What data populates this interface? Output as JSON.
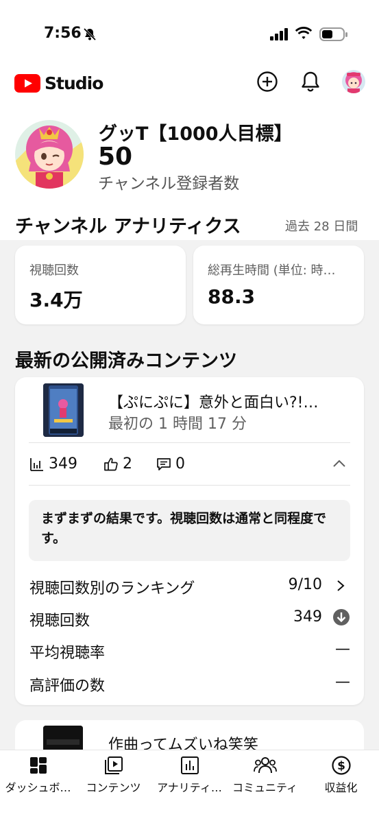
{
  "status_bar": {
    "time": "7:56"
  },
  "header": {
    "logo_text": "Studio"
  },
  "channel": {
    "name": "グッT【1000人目標】",
    "subscribers": "50",
    "subscribers_label": "チャンネル登録者数"
  },
  "analytics": {
    "title": "チャンネル アナリティクス",
    "period": "過去 28 日間",
    "metrics": [
      {
        "label": "視聴回数",
        "value": "3.4万"
      },
      {
        "label": "総再生時間 (単位: 時…",
        "value": "88.3"
      }
    ]
  },
  "latest": {
    "title": "最新の公開済みコンテンツ",
    "video": {
      "title": "【ぷにぷに】意外と面白い?!…",
      "time": "最初の 1 時間 17 分",
      "views": "349",
      "likes": "2",
      "comments": "0",
      "insight": "まずまずの結果です。視聴回数は通常と同程度です。",
      "rows": [
        {
          "label": "視聴回数別のランキング",
          "value": "9/10"
        },
        {
          "label": "視聴回数",
          "value": "349"
        },
        {
          "label": "平均視聴率",
          "value": "—"
        },
        {
          "label": "高評価の数",
          "value": "—"
        }
      ]
    },
    "next_video_title": "作曲ってムズいね笑笑"
  },
  "nav": {
    "items": [
      {
        "label": "ダッシュボ…",
        "icon": "dashboard-icon"
      },
      {
        "label": "コンテンツ",
        "icon": "content-icon"
      },
      {
        "label": "アナリティ…",
        "icon": "analytics-icon"
      },
      {
        "label": "コミュニティ",
        "icon": "community-icon"
      },
      {
        "label": "収益化",
        "icon": "monetization-icon"
      }
    ]
  },
  "colors": {
    "brand_red": "#ff0000",
    "text_primary": "#0f0f0f",
    "text_secondary": "#606060",
    "background": "#f2f2f2"
  }
}
